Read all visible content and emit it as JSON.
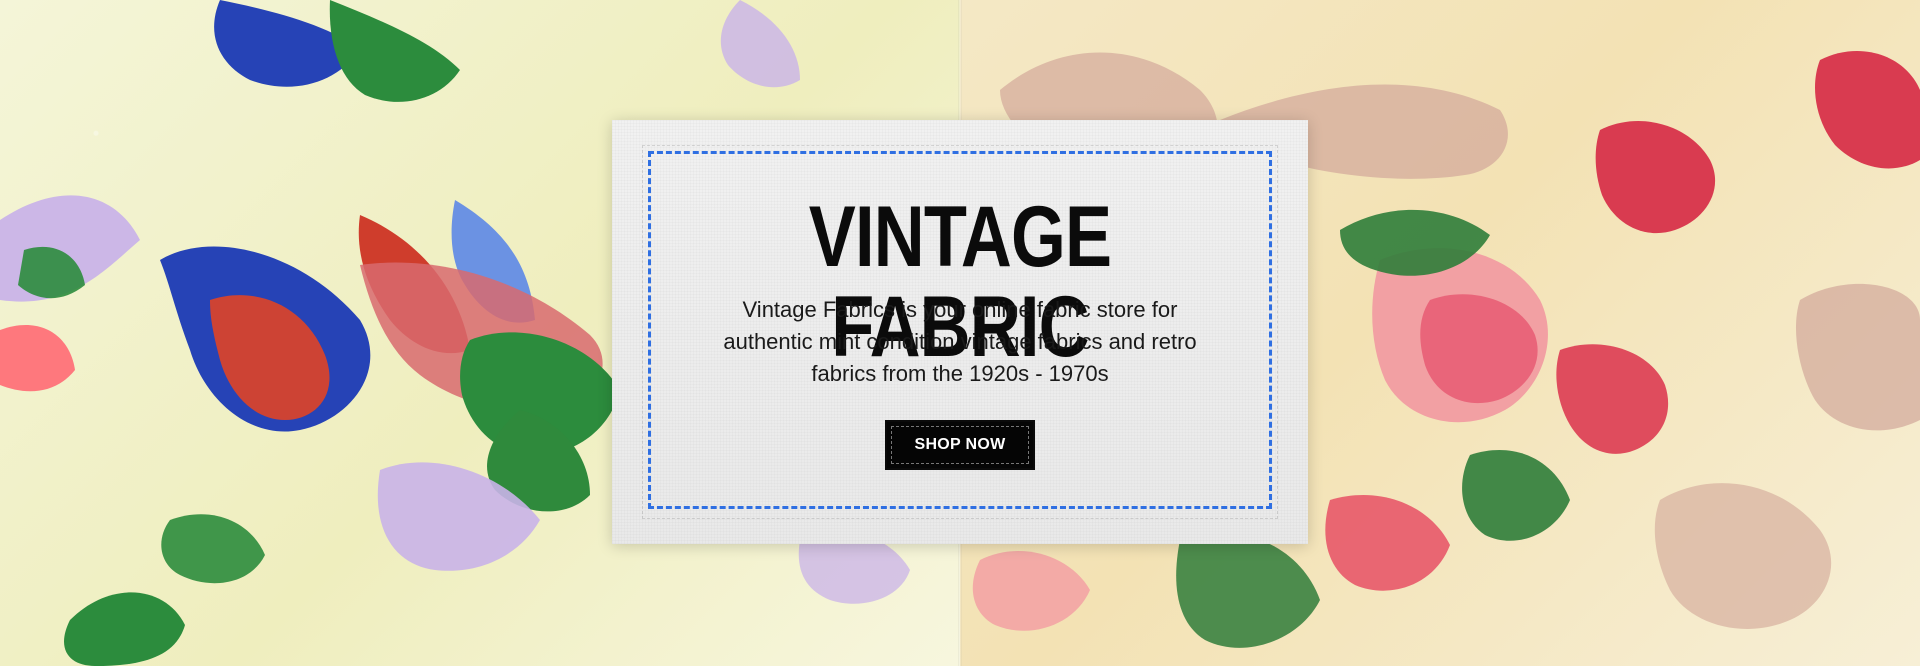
{
  "hero": {
    "title": "VINTAGE FABRIC",
    "description": "Vintage  Fabrics is your online fabric store for authentic mint condition vintage fabrics and retro fabrics from the 1920s - 1970s",
    "button_label": "SHOP NOW"
  },
  "colors": {
    "stitch": "#2f6fe2",
    "button_bg": "#050505",
    "button_text": "#ffffff",
    "left_fabric_bg": "#f4f5d8",
    "right_fabric_bg": "#f4e8c5"
  },
  "icons": [
    "floral-fabric-left-image",
    "floral-fabric-right-image"
  ]
}
